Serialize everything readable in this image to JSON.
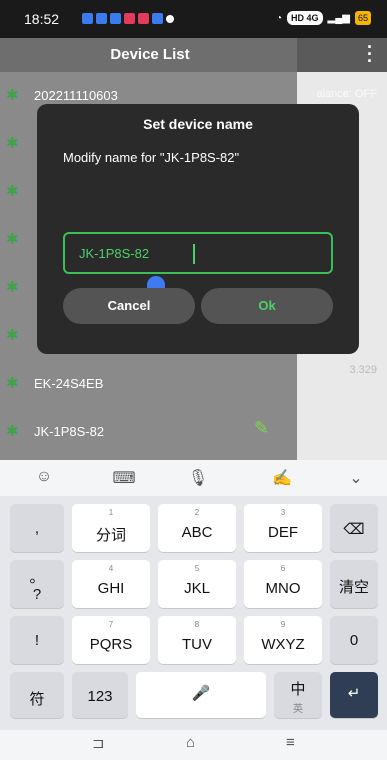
{
  "status": {
    "time": "18:52",
    "network": "HD 4G",
    "battery": "65"
  },
  "app": {
    "title": "Device List",
    "menu_icon": "more-vertical-icon"
  },
  "devices": [
    {
      "name": "202211110603",
      "extra": "alance: OFF"
    },
    {
      "name": "EK-24S4EB",
      "extra": "3.329"
    },
    {
      "name": "JK-1P8S-82"
    }
  ],
  "dialog": {
    "title": "Set device name",
    "message": "Modify name for \"JK-1P8S-82\"",
    "input_value": "JK-1P8S-82",
    "cancel_label": "Cancel",
    "ok_label": "Ok"
  },
  "keyboard": {
    "row1": [
      {
        "sub": "1",
        "main": "分词"
      },
      {
        "sub": "2",
        "main": "ABC"
      },
      {
        "sub": "3",
        "main": "DEF"
      }
    ],
    "row2": [
      {
        "sub": "4",
        "main": "GHI"
      },
      {
        "sub": "5",
        "main": "JKL"
      },
      {
        "sub": "6",
        "main": "MNO"
      }
    ],
    "row3": [
      {
        "sub": "7",
        "main": "PQRS"
      },
      {
        "sub": "8",
        "main": "TUV"
      },
      {
        "sub": "9",
        "main": "WXYZ"
      }
    ],
    "left_keys": [
      ",",
      "。",
      "?",
      "!"
    ],
    "right_keys": {
      "clear": "清空",
      "zero": "0"
    },
    "bottom": {
      "symbols": "符",
      "numbers": "123",
      "lang_main": "中",
      "lang_sub": "英"
    }
  },
  "colors": {
    "accent": "#4cd06a",
    "dialog_bg": "#2a2a2a",
    "enter_key": "#2f3d55"
  }
}
